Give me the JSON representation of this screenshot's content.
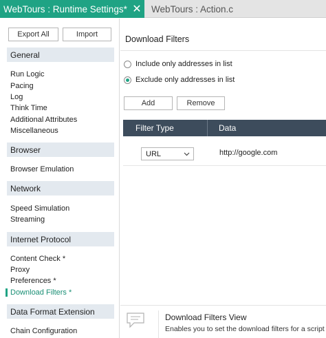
{
  "tabs": [
    {
      "label": "WebTours : Runtime Settings*",
      "active": true
    },
    {
      "label": "WebTours : Action.c",
      "active": false
    }
  ],
  "sidebar": {
    "export_label": "Export All",
    "import_label": "Import",
    "sections": [
      {
        "header": "General",
        "items": [
          "Run Logic",
          "Pacing",
          "Log",
          "Think Time",
          "Additional Attributes",
          "Miscellaneous"
        ]
      },
      {
        "header": "Browser",
        "items": [
          "Browser Emulation"
        ]
      },
      {
        "header": "Network",
        "items": [
          "Speed Simulation",
          "Streaming"
        ]
      },
      {
        "header": "Internet Protocol",
        "items": [
          "Content Check *",
          "Proxy",
          "Preferences *",
          "Download Filters *"
        ]
      },
      {
        "header": "Data Format Extension",
        "items": [
          "Chain Configuration"
        ]
      }
    ],
    "selected_item": "Download Filters *"
  },
  "main": {
    "title": "Download Filters",
    "radio_include": "Include only addresses in list",
    "radio_exclude": "Exclude only addresses in list",
    "selected_radio": "exclude",
    "add_label": "Add",
    "remove_label": "Remove",
    "table": {
      "columns": [
        "Filter Type",
        "Data"
      ],
      "rows": [
        {
          "filter_type": "URL",
          "data": "http://google.com"
        }
      ]
    }
  },
  "help": {
    "title": "Download Filters View",
    "description": "Enables you to set the download filters for a script"
  },
  "colors": {
    "accent": "#1fa384",
    "table_header": "#3d4c5c",
    "section_header": "#e3e9ef"
  }
}
